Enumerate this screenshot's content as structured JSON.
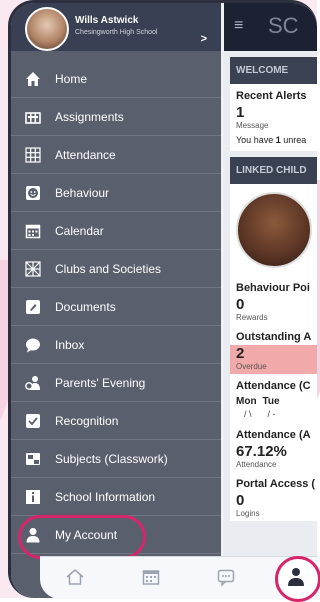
{
  "profile": {
    "name": "Wills Astwick",
    "school": "Chesingworth High School",
    "chevron_icon": "chevron-right-icon"
  },
  "menu": [
    {
      "label": "Home",
      "icon": "home-icon"
    },
    {
      "label": "Assignments",
      "icon": "assignments-icon"
    },
    {
      "label": "Attendance",
      "icon": "attendance-grid-icon"
    },
    {
      "label": "Behaviour",
      "icon": "smiley-icon"
    },
    {
      "label": "Calendar",
      "icon": "calendar-icon"
    },
    {
      "label": "Clubs and Societies",
      "icon": "clubs-icon"
    },
    {
      "label": "Documents",
      "icon": "document-icon"
    },
    {
      "label": "Inbox",
      "icon": "inbox-icon"
    },
    {
      "label": "Parents' Evening",
      "icon": "parents-evening-icon"
    },
    {
      "label": "Recognition",
      "icon": "checkbox-icon"
    },
    {
      "label": "Subjects (Classwork)",
      "icon": "subjects-icon"
    },
    {
      "label": "School Information",
      "icon": "info-icon"
    },
    {
      "label": "My Account",
      "icon": "user-icon"
    }
  ],
  "app": {
    "title": "SC",
    "welcome": "WELCOME",
    "recent_alerts": "Recent Alerts",
    "alerts_count": "1",
    "alerts_sub": "Message",
    "alerts_line_pre": "You have ",
    "alerts_line_num": "1",
    "alerts_line_post": " unrea",
    "linked": "LINKED CHILD",
    "behaviour": "Behaviour Poi",
    "behaviour_val": "0",
    "behaviour_sub": "Rewards",
    "outstanding": "Outstanding A",
    "outstanding_val": "2",
    "outstanding_sub": "Overdue",
    "attendance_week": "Attendance (C",
    "day1": "Mon",
    "day2": "Tue",
    "mark1": "/ \\",
    "mark2": "/ -",
    "attendance_pct_title": "Attendance (A",
    "attendance_pct": "67.12%",
    "attendance_sub": "Attendance",
    "portal": "Portal Access (",
    "portal_val": "0",
    "portal_sub": "Logins"
  },
  "bottom_nav": [
    {
      "icon": "home-outline-icon"
    },
    {
      "icon": "calendar-outline-icon"
    },
    {
      "icon": "chat-icon"
    },
    {
      "icon": "user-icon"
    }
  ],
  "colors": {
    "highlight": "#d7256c",
    "drawer": "#5a5f6e",
    "header": "#3a4053"
  }
}
